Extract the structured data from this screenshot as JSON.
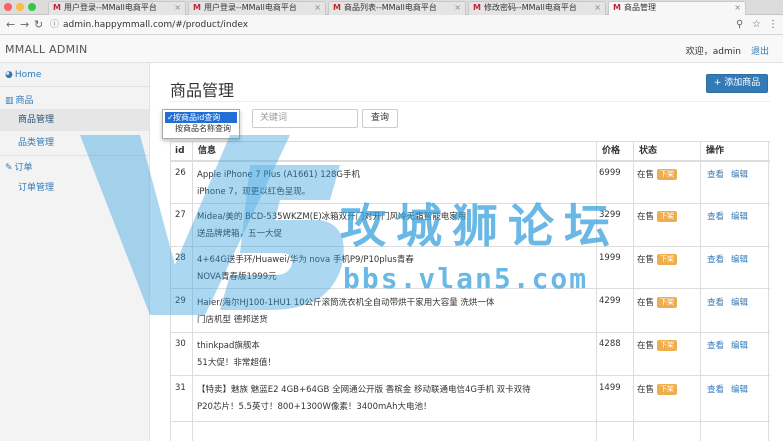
{
  "browser": {
    "tabs": [
      {
        "title": "用户登录--MMall电商平台"
      },
      {
        "title": "用户登录--MMall电商平台"
      },
      {
        "title": "商品列表--MMall电商平台"
      },
      {
        "title": "修改密码--MMall电商平台"
      },
      {
        "title": "商品管理"
      }
    ],
    "url": "admin.happymmall.com/#/product/index",
    "tab_close": "×"
  },
  "header": {
    "brand": "MMALL ADMIN",
    "welcome": "欢迎，admin",
    "logout": "退出"
  },
  "sidebar": {
    "home": "Home",
    "product_group": "商品",
    "product_manage": "商品管理",
    "category_manage": "品类管理",
    "order_group": "订单",
    "order_manage": "订单管理"
  },
  "page": {
    "title": "商品管理",
    "add_button": "+ 添加商品"
  },
  "search": {
    "options": [
      "按商品id查询",
      "按商品名称查询"
    ],
    "selected": "按商品id查询",
    "placeholder": "关键词",
    "button": "查询"
  },
  "table": {
    "headers": [
      "id",
      "信息",
      "价格",
      "状态",
      "操作"
    ],
    "status_text": "在售",
    "off_shelf_label": "下架",
    "view_label": "查看",
    "edit_label": "编辑",
    "rows": [
      {
        "id": "26",
        "name": "Apple iPhone 7 Plus (A1661) 128G手机",
        "subtitle": "iPhone 7，现更以红色呈现。",
        "price": "6999"
      },
      {
        "id": "27",
        "name": "Midea/美的 BCD-535WKZM(E)冰箱双开门对开门风冷无霜智能电家用",
        "subtitle": "送品牌烤箱，五一大促",
        "price": "3299"
      },
      {
        "id": "28",
        "name": "4+64G送手环/Huawei/华为 nova 手机P9/P10plus青春",
        "subtitle": "NOVA青春版1999元",
        "price": "1999"
      },
      {
        "id": "29",
        "name": "Haier/海尔HJ100-1HU1 10公斤滚筒洗衣机全自动带烘干家用大容量 洗烘一体",
        "subtitle": "门店机型 德邦送货",
        "price": "4299"
      },
      {
        "id": "30",
        "name": "thinkpad旗舰本",
        "subtitle": "51大促！非常超值！",
        "price": "4288"
      },
      {
        "id": "31",
        "name": "【特卖】魅族 魅蓝E2 4GB+64GB 全网通公开版 香槟金 移动联通电信4G手机 双卡双待",
        "subtitle": "P20芯片！5.5英寸！800+1300W像素！3400mAh大电池！",
        "price": "1499"
      }
    ]
  },
  "watermark": {
    "text": "攻城狮论坛",
    "url": "bbs.vlan5.com"
  },
  "colors": {
    "link": "#337ab7",
    "primary_button": "#337ab7",
    "badge": "#f0ad4e",
    "watermark": "#2a9bdc"
  }
}
